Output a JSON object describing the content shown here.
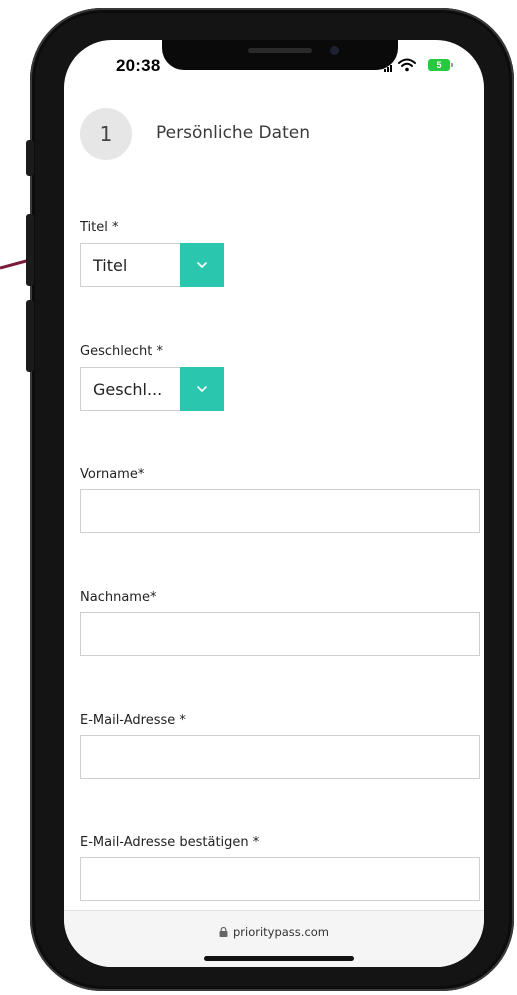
{
  "status_bar": {
    "time": "20:38",
    "battery": "5"
  },
  "step": {
    "number": "1",
    "title": "Persönliche Daten"
  },
  "form": {
    "title_label": "Titel *",
    "title_value": "Titel",
    "gender_label": "Geschlecht *",
    "gender_value": "Geschl...",
    "first_name_label": "Vorname*",
    "first_name_value": "",
    "last_name_label": "Nachname*",
    "last_name_value": "",
    "email_label": "E-Mail-Adresse *",
    "email_value": "",
    "email_confirm_label": "E-Mail-Adresse bestätigen *",
    "email_confirm_value": ""
  },
  "browser": {
    "url": "prioritypass.com"
  },
  "colors": {
    "accent": "#2ac7ae",
    "accent_line": "#7a1a3c"
  }
}
